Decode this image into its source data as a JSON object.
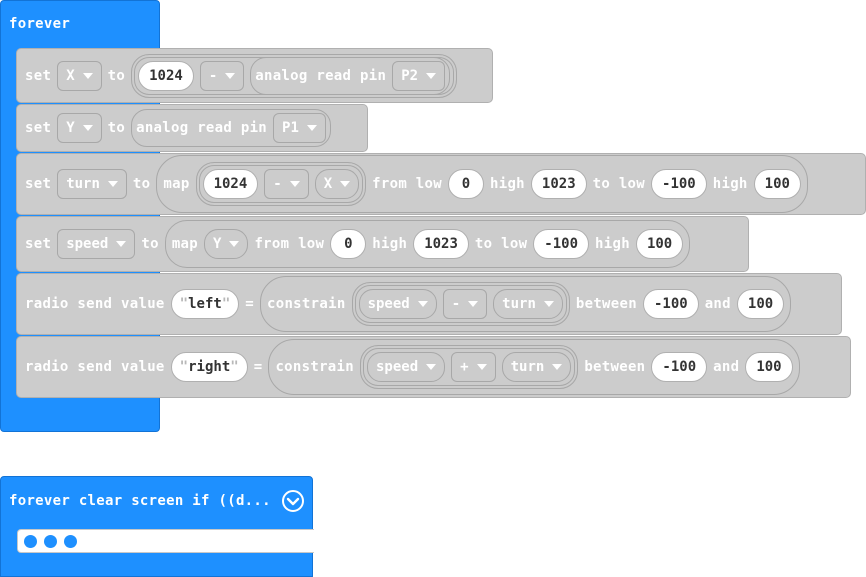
{
  "forever_block": {
    "title": "forever",
    "statements": [
      {
        "kw": [
          "set",
          "to"
        ],
        "var": "X",
        "op": "-",
        "num": "1024",
        "fn": "analog read pin",
        "pin": "P2"
      },
      {
        "kw": [
          "set",
          "to"
        ],
        "var": "Y",
        "fn": "analog read pin",
        "pin": "P1"
      },
      {
        "kw": [
          "set",
          "to",
          "map",
          "from low",
          "high",
          "to low",
          "high"
        ],
        "var": "turn",
        "num": "1024",
        "op": "-",
        "ref": "X",
        "low1": "0",
        "high1": "1023",
        "low2": "-100",
        "high2": "100"
      },
      {
        "kw": [
          "set",
          "to",
          "map",
          "from low",
          "high",
          "to low",
          "high"
        ],
        "var": "speed",
        "ref": "Y",
        "low1": "0",
        "high1": "1023",
        "low2": "-100",
        "high2": "100"
      },
      {
        "kw": [
          "radio send value",
          "=",
          "constrain",
          "between",
          "and"
        ],
        "str": "left",
        "a": "speed",
        "op": "-",
        "b": "turn",
        "min": "-100",
        "max": "100"
      },
      {
        "kw": [
          "radio send value",
          "=",
          "constrain",
          "between",
          "and"
        ],
        "str": "right",
        "a": "speed",
        "op": "+",
        "b": "turn",
        "min": "-100",
        "max": "100"
      }
    ]
  },
  "collapsed_block": {
    "title": "forever clear screen if ((d...",
    "expand_icon": "chevron-down-circle-icon",
    "overflow_icon": "ellipsis-dots-icon"
  },
  "colors": {
    "event_blue": "#1e90ff",
    "variable_gray": "#cccccc",
    "slot_white": "#ffffff"
  }
}
